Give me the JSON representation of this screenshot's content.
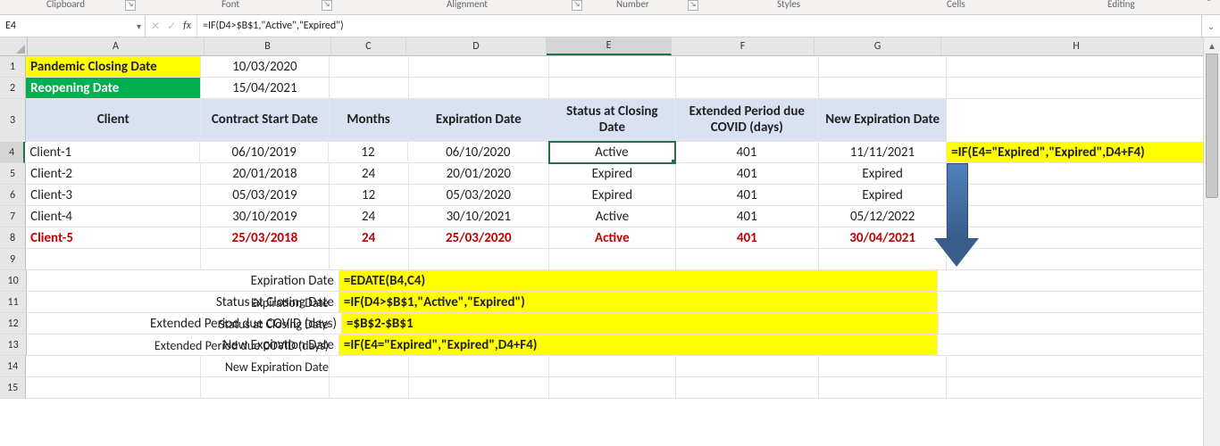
{
  "ribbon_groups": {
    "clipboard": "Clipboard",
    "font": "Font",
    "alignment": "Alignment",
    "number": "Number",
    "styles": "Styles",
    "cells": "Cells",
    "editing": "Editing"
  },
  "namebox": {
    "value": "E4"
  },
  "fx_icons": {
    "cancel": "✕",
    "enter": "✓",
    "fx": "fx"
  },
  "formula_bar": {
    "value": "=IF(D4>$B$1,\"Active\",\"Expired\")"
  },
  "columns": {
    "A": "A",
    "B": "B",
    "C": "C",
    "D": "D",
    "E": "E",
    "F": "F",
    "G": "G",
    "H": "H"
  },
  "row_nums": [
    "1",
    "2",
    "3",
    "4",
    "5",
    "6",
    "7",
    "8",
    "9",
    "10",
    "11",
    "12",
    "13",
    "14",
    "15"
  ],
  "cells": {
    "A1": "Pandemic Closing Date",
    "B1": "10/03/2020",
    "A2": "Reopening Date",
    "B2": "15/04/2021",
    "hdr": {
      "A": "Client",
      "B": "Contract Start Date",
      "C": "Months",
      "D": "Expiration Date",
      "E": "Status at Closing Date",
      "F": "Extended Period due COVID (days)",
      "G": "New Expiration Date"
    },
    "r4": {
      "A": "Client-1",
      "B": "06/10/2019",
      "C": "12",
      "D": "06/10/2020",
      "E": "Active",
      "F": "401",
      "G": "11/11/2021",
      "H": "=IF(E4=\"Expired\",\"Expired\",D4+F4)"
    },
    "r5": {
      "A": "Client-2",
      "B": "20/01/2018",
      "C": "24",
      "D": "20/01/2020",
      "E": "Expired",
      "F": "401",
      "G": "Expired"
    },
    "r6": {
      "A": "Client-3",
      "B": "05/03/2019",
      "C": "12",
      "D": "05/03/2020",
      "E": "Expired",
      "F": "401",
      "G": "Expired"
    },
    "r7": {
      "A": "Client-4",
      "B": "30/10/2019",
      "C": "24",
      "D": "30/10/2021",
      "E": "Active",
      "F": "401",
      "G": "05/12/2022"
    },
    "r8": {
      "A": "Client-5",
      "B": "25/03/2018",
      "C": "24",
      "D": "25/03/2020",
      "E": "Active",
      "F": "401",
      "G": "30/04/2021"
    },
    "r10": {
      "label": "Expiration Date",
      "formula": "=EDATE(B4,C4)"
    },
    "r11": {
      "label": "Status at Closing Date",
      "formula": "=IF(D4>$B$1,\"Active\",\"Expired\")"
    },
    "r12": {
      "label": "Extended Period due COVID (days)",
      "formula": "=$B$2-$B$1"
    },
    "r13": {
      "label": "New Expiration Date",
      "formula": "=IF(E4=\"Expired\",\"Expired\",D4+F4)"
    }
  }
}
